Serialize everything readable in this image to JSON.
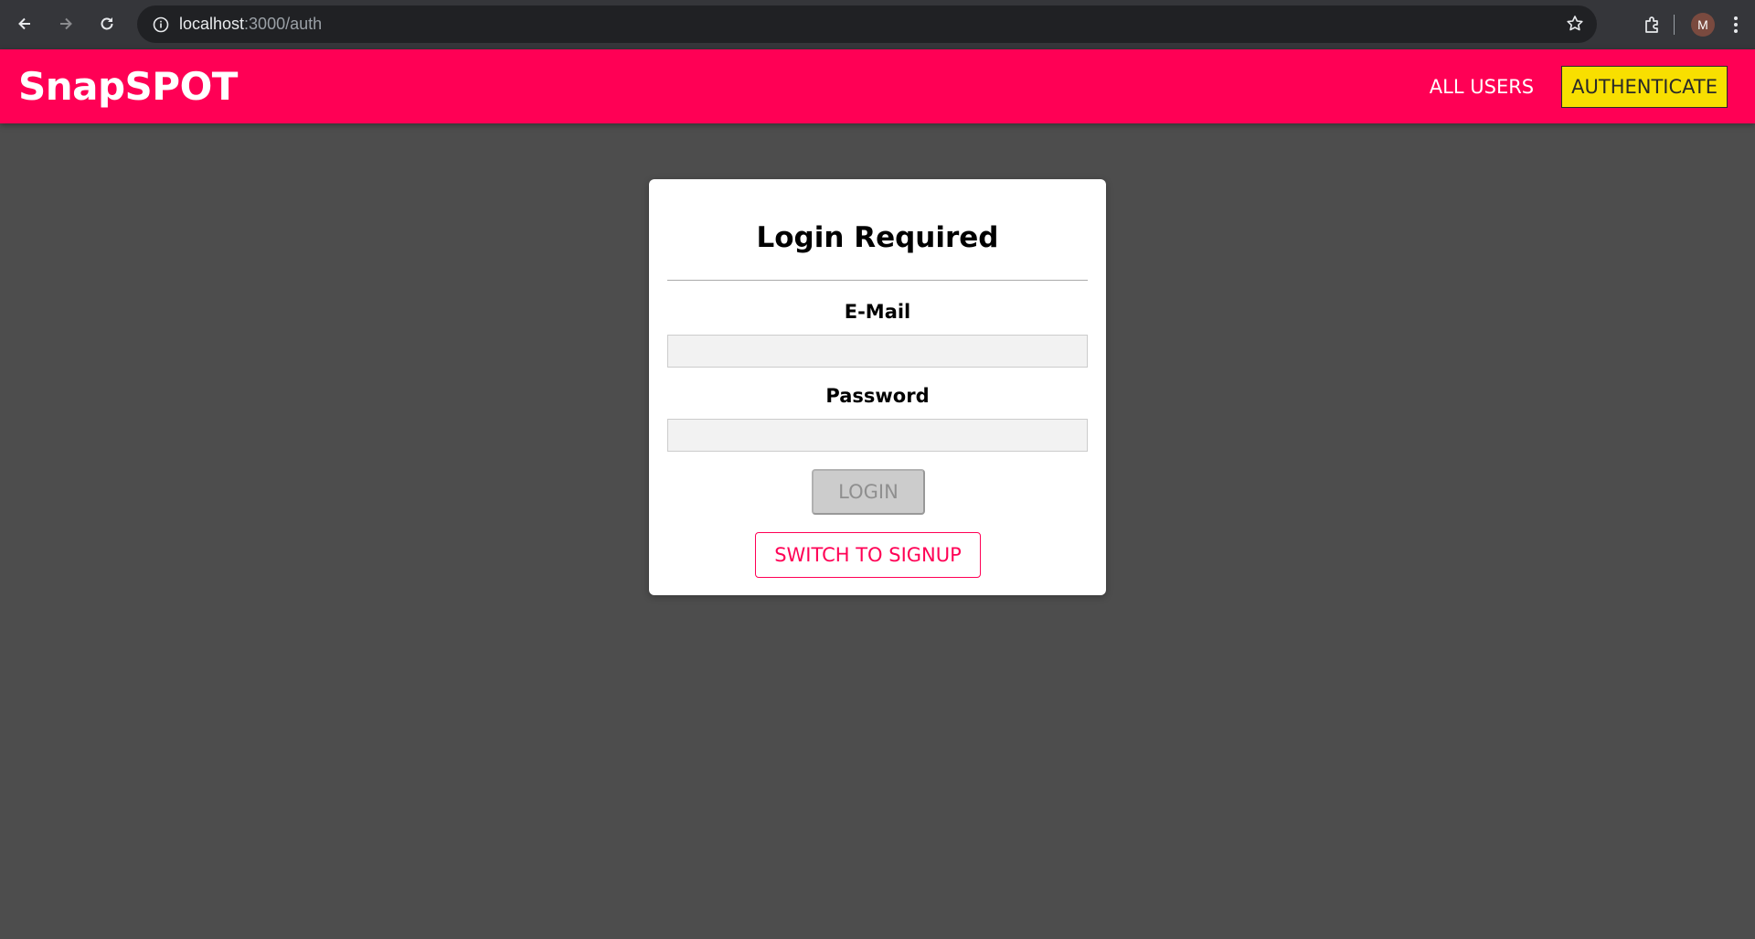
{
  "browser": {
    "url_host": "localhost",
    "url_rest": ":3000/auth",
    "avatar_initial": "M"
  },
  "header": {
    "logo": "SnapSPOT",
    "brand_color": "#ff0055",
    "nav": [
      {
        "label": "ALL USERS",
        "active": false
      },
      {
        "label": "AUTHENTICATE",
        "active": true
      }
    ]
  },
  "auth": {
    "title": "Login Required",
    "email_label": "E-Mail",
    "email_value": "",
    "password_label": "Password",
    "password_value": "",
    "login_label": "LOGIN",
    "login_disabled": true,
    "switch_label": "SWITCH TO SIGNUP"
  }
}
